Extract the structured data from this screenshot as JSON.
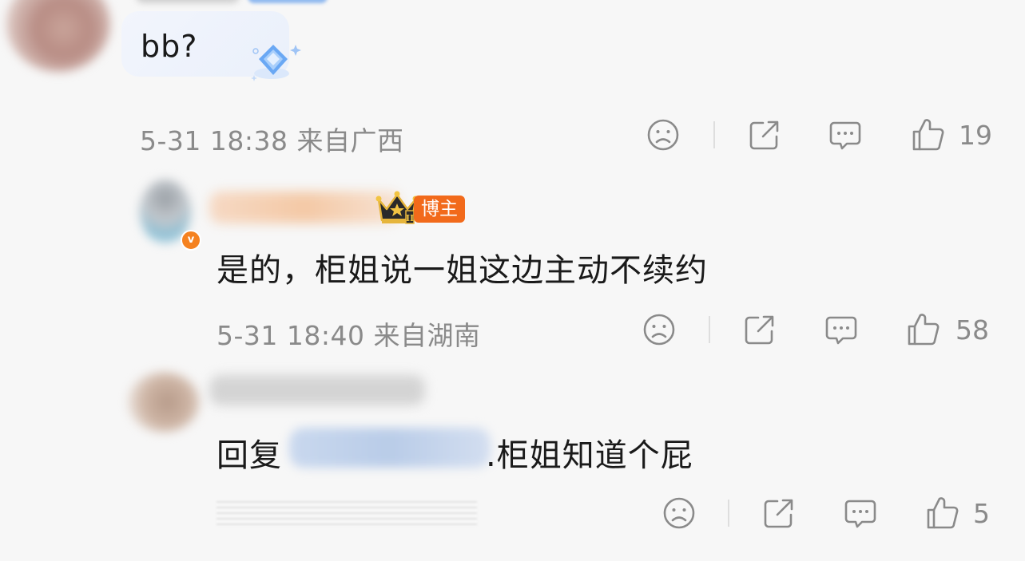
{
  "comment1": {
    "text": "bb?",
    "meta": "5-31 18:38  来自广西",
    "like_count": "19"
  },
  "comment2": {
    "author_badge": "博主",
    "verified_mark": "v",
    "text": "是的，柜姐说一姐这边主动不续约",
    "meta": "5-31 18:40  来自湖南",
    "like_count": "58"
  },
  "comment3": {
    "reply_prefix": "回复",
    "reply_rest": ".柜姐知道个屁",
    "like_count": "5"
  },
  "icons": {
    "dislike": "sad-face-icon",
    "share": "share-icon",
    "comment": "comment-icon",
    "like": "thumbs-up-icon"
  },
  "colors": {
    "background": "#f7f7f7",
    "meta_text": "#8a8a8a",
    "bozhu_badge": "#f26a1b",
    "verified": "#f58220"
  }
}
